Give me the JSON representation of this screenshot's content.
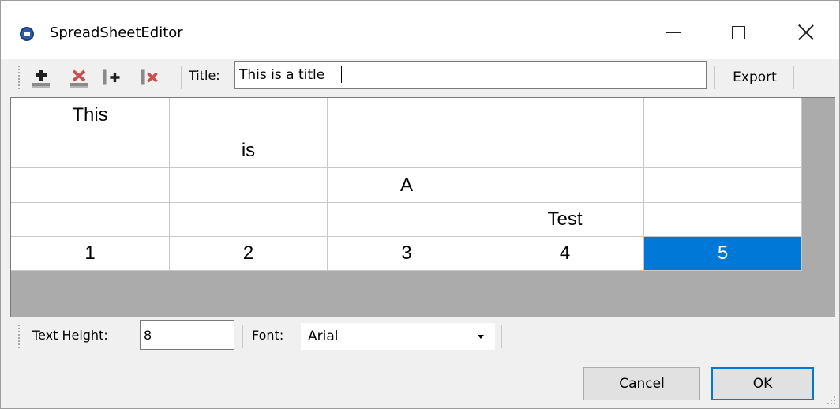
{
  "window": {
    "title": "SpreadSheetEditor",
    "controls": [
      "minimize-icon",
      "maximize-icon",
      "close-icon"
    ]
  },
  "toolbar": {
    "buttons": [
      {
        "name": "add-row-icon"
      },
      {
        "name": "delete-row-icon"
      },
      {
        "name": "add-column-icon"
      },
      {
        "name": "delete-column-icon"
      }
    ],
    "title_label": "Title:",
    "title_value": "This is a title",
    "export_label": "Export"
  },
  "grid": {
    "rows": [
      [
        "This",
        "",
        "",
        "",
        ""
      ],
      [
        "",
        "is",
        "",
        "",
        ""
      ],
      [
        "",
        "",
        "A",
        "",
        ""
      ],
      [
        "",
        "",
        "",
        "Test",
        ""
      ],
      [
        "1",
        "2",
        "3",
        "4",
        "5"
      ]
    ],
    "selected": {
      "row": 4,
      "col": 4
    },
    "selection_color": "#0078d7"
  },
  "bottom_toolbar": {
    "text_height_label": "Text Height:",
    "text_height_value": "8",
    "font_label": "Font:",
    "font_value": "Arial"
  },
  "buttons": {
    "cancel": "Cancel",
    "ok": "OK"
  }
}
